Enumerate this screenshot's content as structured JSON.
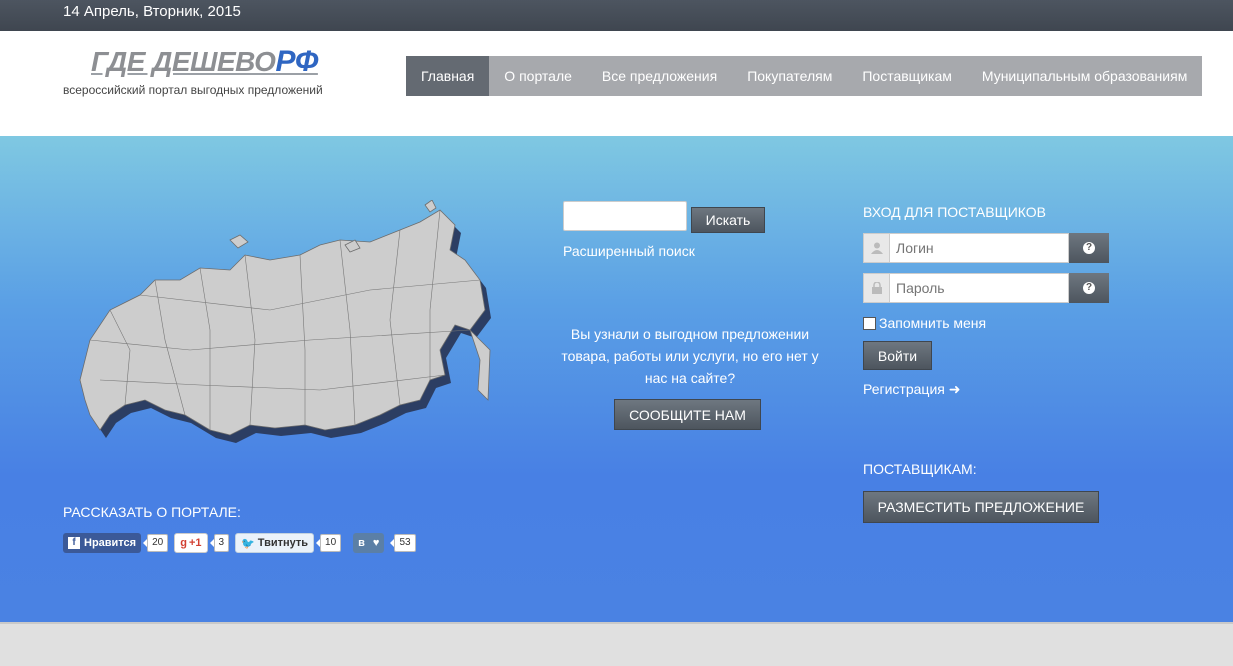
{
  "topbar": {
    "date": "14 Апрель, Вторник, 2015"
  },
  "logo": {
    "main": "ГДЕ ДЕШЕВО",
    "rf": "РФ",
    "subtitle": "всероссийский портал выгодных предложений"
  },
  "nav": {
    "items": [
      {
        "label": "Главная",
        "active": true
      },
      {
        "label": "О портале"
      },
      {
        "label": "Все предложения"
      },
      {
        "label": "Покупателям"
      },
      {
        "label": "Поставщикам"
      },
      {
        "label": "Муниципальным образованиям"
      }
    ]
  },
  "search": {
    "placeholder": "",
    "button": "Искать",
    "advanced": "Расширенный поиск"
  },
  "promo": {
    "text": "Вы узнали о выгодном предложении товара, работы или услуги, но его нет у нас на сайте?",
    "button": "СООБЩИТЕ НАМ"
  },
  "login": {
    "title": "ВХОД ДЛЯ ПОСТАВЩИКОВ",
    "login_placeholder": "Логин",
    "password_placeholder": "Пароль",
    "remember": "Запомнить меня",
    "button": "Войти",
    "register": "Регистрация"
  },
  "suppliers": {
    "title": "ПОСТАВЩИКАМ:",
    "button": "РАЗМЕСТИТЬ ПРЕДЛОЖЕНИЕ"
  },
  "share": {
    "title": "РАССКАЗАТЬ О ПОРТАЛЕ:",
    "facebook": {
      "label": "Нравится",
      "count": "20"
    },
    "gplus": {
      "label": "+1",
      "count": "3"
    },
    "twitter": {
      "label": "Твитнуть",
      "count": "10"
    },
    "vk": {
      "label": "в",
      "count": "53"
    }
  },
  "colors": {
    "accent": "#4a82e3",
    "nav_active": "#646a72",
    "nav_bg": "#a7a9ad",
    "topbar": "#444b55"
  },
  "icons": [
    "user-icon",
    "lock-icon",
    "help-icon",
    "arrow-right-icon",
    "facebook-icon",
    "twitter-icon",
    "heart-icon",
    "russia-map"
  ]
}
